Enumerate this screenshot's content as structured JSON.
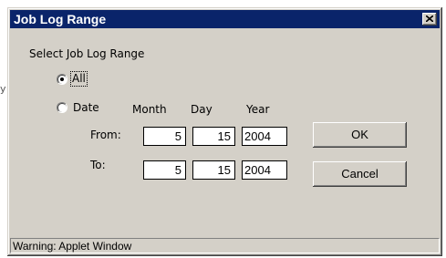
{
  "dialog": {
    "title": "Job Log Range",
    "close_icon": "close-icon"
  },
  "group": {
    "label": "Select Job Log Range",
    "radio_all": {
      "label": "All",
      "selected": true
    },
    "radio_date": {
      "label": "Date",
      "selected": false
    }
  },
  "columns": {
    "month": "Month",
    "day": "Day",
    "year": "Year"
  },
  "from": {
    "label": "From:",
    "month": "5",
    "day": "15",
    "year": "2004"
  },
  "to": {
    "label": "To:",
    "month": "5",
    "day": "15",
    "year": "2004"
  },
  "buttons": {
    "ok": "OK",
    "cancel": "Cancel"
  },
  "status": {
    "text": "Warning: Applet Window"
  }
}
